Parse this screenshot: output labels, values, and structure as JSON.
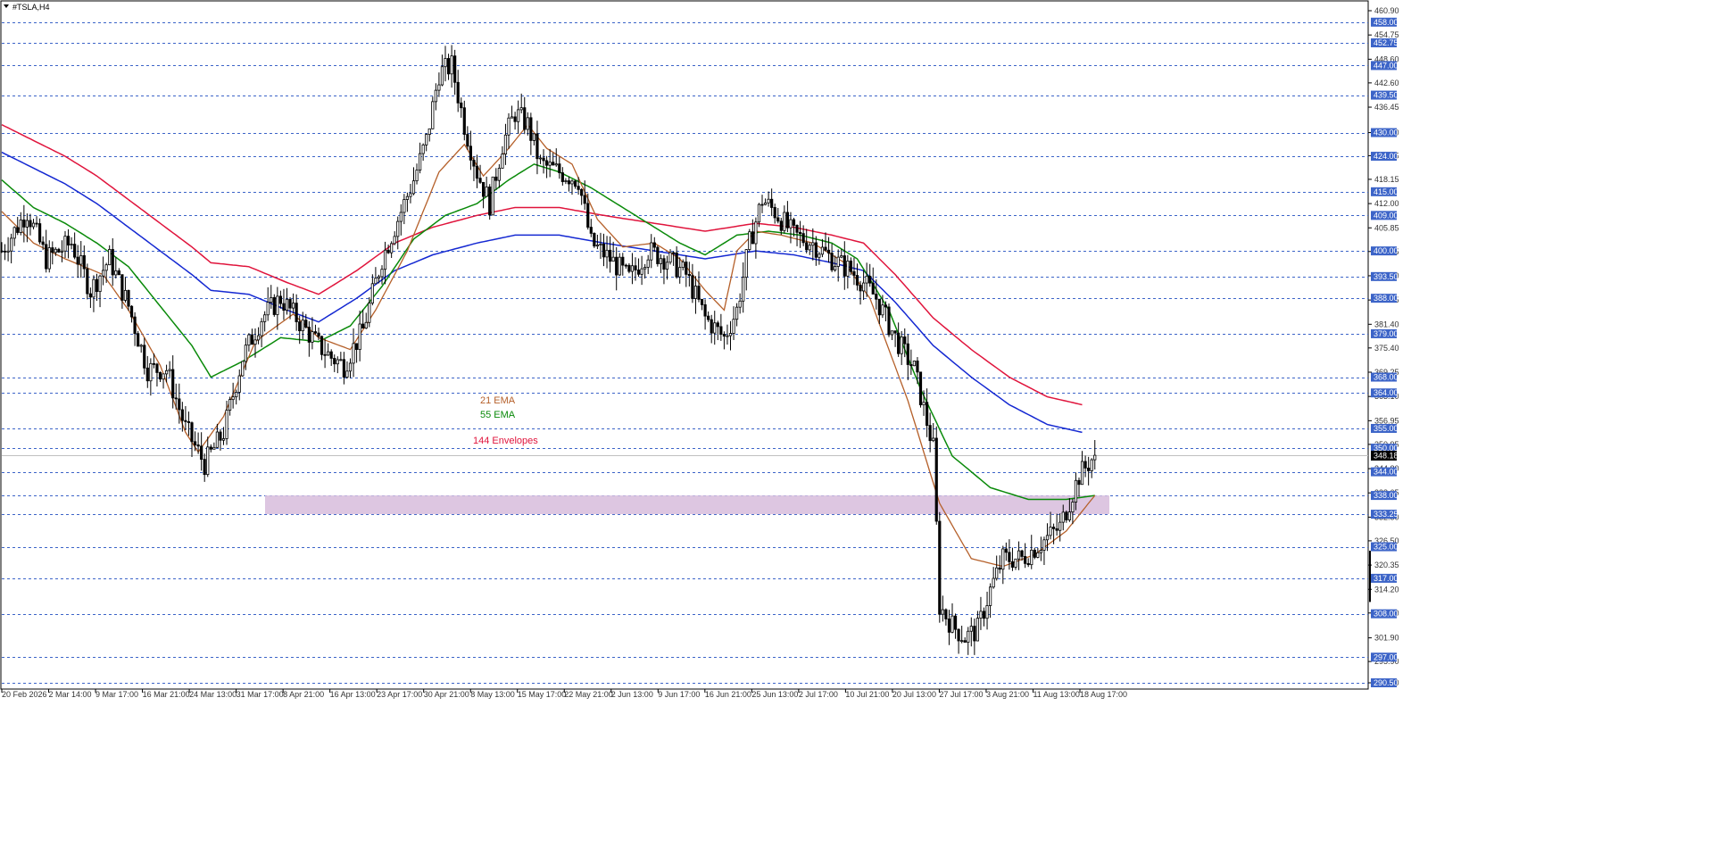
{
  "symbol": "#TSLA,H4",
  "chart_data": {
    "type": "candlestick",
    "title": "#TSLA,H4",
    "y_axis": {
      "min": 290.5,
      "max": 460.9,
      "ticks": [
        460.9,
        454.75,
        448.6,
        442.6,
        436.45,
        430.0,
        424.15,
        418.15,
        412.0,
        405.85,
        399.85,
        393.7,
        387.55,
        381.4,
        375.4,
        369.25,
        363.1,
        356.95,
        350.95,
        344.8,
        338.65,
        332.5,
        326.5,
        320.35,
        314.2,
        308.2,
        301.9,
        295.9,
        290.5
      ]
    },
    "x_axis": {
      "labels": [
        "20 Feb 2026",
        "2 Mar 14:00",
        "9 Mar 17:00",
        "16 Mar 21:00",
        "24 Mar 13:00",
        "31 Mar 17:00",
        "8 Apr 21:00",
        "16 Apr 13:00",
        "23 Apr 17:00",
        "30 Apr 21:00",
        "8 May 13:00",
        "15 May 17:00",
        "22 May 21:00",
        "2 Jun 13:00",
        "9 Jun 17:00",
        "16 Jun 21:00",
        "25 Jun 13:00",
        "2 Jul 17:00",
        "10 Jul 21:00",
        "20 Jul 13:00",
        "27 Jul 17:00",
        "3 Aug 21:00",
        "11 Aug 13:00",
        "18 Aug 17:00"
      ]
    },
    "horizontal_levels": [
      458.0,
      452.75,
      447.0,
      439.5,
      430.0,
      424.0,
      415.0,
      409.0,
      400.0,
      393.5,
      388.0,
      379.0,
      368.0,
      364.0,
      355.0,
      350.0,
      344.0,
      338.0,
      333.25,
      325.0,
      317.0,
      308.0,
      297.0,
      290.5
    ],
    "current_price": 348.18,
    "support_zone": {
      "low": 333.25,
      "high": 338.0
    },
    "annotations": [
      "21 EMA",
      "55 EMA",
      "144 Envelopes"
    ],
    "colors": {
      "ema21": "#b5602a",
      "ema55": "#0a8a0a",
      "envelope_upper": "#e0143c",
      "envelope_lower": "#1428d2",
      "level_line": "#3c64c8",
      "label_box": "#3c64c8",
      "zone": "#d9c0de",
      "candle": "#000000",
      "current_price_box": "#000000"
    },
    "series": [
      {
        "name": "21 EMA",
        "anchors": [
          [
            0,
            410
          ],
          [
            10,
            402
          ],
          [
            20,
            398
          ],
          [
            32,
            394
          ],
          [
            40,
            385
          ],
          [
            50,
            371
          ],
          [
            58,
            354
          ],
          [
            62,
            349
          ],
          [
            70,
            358
          ],
          [
            80,
            377
          ],
          [
            92,
            384
          ],
          [
            100,
            378
          ],
          [
            110,
            375
          ],
          [
            118,
            385
          ],
          [
            128,
            400
          ],
          [
            138,
            420
          ],
          [
            146,
            427
          ],
          [
            152,
            419
          ],
          [
            160,
            426
          ],
          [
            166,
            432
          ],
          [
            172,
            426
          ],
          [
            180,
            422
          ],
          [
            188,
            408
          ],
          [
            196,
            401
          ],
          [
            206,
            402
          ],
          [
            214,
            398
          ],
          [
            222,
            390
          ],
          [
            228,
            385
          ],
          [
            232,
            400
          ],
          [
            238,
            405
          ],
          [
            246,
            404
          ],
          [
            256,
            402
          ],
          [
            266,
            397
          ],
          [
            274,
            388
          ],
          [
            286,
            362
          ],
          [
            296,
            336
          ],
          [
            306,
            322
          ],
          [
            316,
            320
          ],
          [
            326,
            323
          ],
          [
            336,
            329
          ],
          [
            345,
            338
          ]
        ]
      },
      {
        "name": "55 EMA",
        "anchors": [
          [
            0,
            418
          ],
          [
            10,
            411
          ],
          [
            20,
            407
          ],
          [
            30,
            402
          ],
          [
            40,
            396
          ],
          [
            50,
            386
          ],
          [
            60,
            376
          ],
          [
            66,
            368
          ],
          [
            76,
            372
          ],
          [
            88,
            378
          ],
          [
            100,
            377
          ],
          [
            110,
            381
          ],
          [
            120,
            391
          ],
          [
            130,
            403
          ],
          [
            140,
            409
          ],
          [
            150,
            412
          ],
          [
            160,
            418
          ],
          [
            168,
            422
          ],
          [
            176,
            420
          ],
          [
            186,
            416
          ],
          [
            196,
            411
          ],
          [
            206,
            406
          ],
          [
            214,
            402
          ],
          [
            222,
            399
          ],
          [
            232,
            404
          ],
          [
            242,
            405
          ],
          [
            252,
            404
          ],
          [
            262,
            402
          ],
          [
            270,
            398
          ],
          [
            280,
            385
          ],
          [
            290,
            365
          ],
          [
            300,
            348
          ],
          [
            312,
            340
          ],
          [
            324,
            337
          ],
          [
            336,
            337
          ],
          [
            345,
            338
          ]
        ]
      },
      {
        "name": "upper envelope",
        "anchors": [
          [
            0,
            432
          ],
          [
            10,
            428
          ],
          [
            20,
            424
          ],
          [
            30,
            419
          ],
          [
            40,
            413
          ],
          [
            50,
            407
          ],
          [
            60,
            401
          ],
          [
            66,
            397
          ],
          [
            78,
            396
          ],
          [
            90,
            392
          ],
          [
            100,
            389
          ],
          [
            112,
            395
          ],
          [
            124,
            402
          ],
          [
            136,
            406
          ],
          [
            150,
            409
          ],
          [
            162,
            411
          ],
          [
            176,
            411
          ],
          [
            190,
            409
          ],
          [
            206,
            407
          ],
          [
            222,
            405
          ],
          [
            238,
            407
          ],
          [
            250,
            406
          ],
          [
            262,
            404
          ],
          [
            272,
            402
          ],
          [
            282,
            394
          ],
          [
            294,
            383
          ],
          [
            306,
            375
          ],
          [
            318,
            368
          ],
          [
            330,
            363
          ],
          [
            341,
            361
          ]
        ]
      },
      {
        "name": "lower envelope",
        "anchors": [
          [
            0,
            425
          ],
          [
            10,
            421
          ],
          [
            20,
            417
          ],
          [
            30,
            412
          ],
          [
            40,
            406
          ],
          [
            50,
            400
          ],
          [
            60,
            394
          ],
          [
            66,
            390
          ],
          [
            78,
            389
          ],
          [
            90,
            385
          ],
          [
            100,
            382
          ],
          [
            112,
            388
          ],
          [
            124,
            395
          ],
          [
            136,
            399
          ],
          [
            150,
            402
          ],
          [
            162,
            404
          ],
          [
            176,
            404
          ],
          [
            190,
            402
          ],
          [
            206,
            400
          ],
          [
            222,
            398
          ],
          [
            238,
            400
          ],
          [
            250,
            399
          ],
          [
            262,
            397
          ],
          [
            272,
            395
          ],
          [
            282,
            387
          ],
          [
            294,
            376
          ],
          [
            306,
            368
          ],
          [
            318,
            361
          ],
          [
            330,
            356
          ],
          [
            341,
            354
          ]
        ]
      },
      {
        "name": "price",
        "anchors": [
          [
            0,
            400
          ],
          [
            8,
            410
          ],
          [
            14,
            398
          ],
          [
            22,
            402
          ],
          [
            28,
            390
          ],
          [
            34,
            398
          ],
          [
            40,
            386
          ],
          [
            46,
            370
          ],
          [
            52,
            370
          ],
          [
            58,
            355
          ],
          [
            64,
            346
          ],
          [
            70,
            354
          ],
          [
            76,
            373
          ],
          [
            82,
            383
          ],
          [
            88,
            388
          ],
          [
            94,
            382
          ],
          [
            100,
            376
          ],
          [
            104,
            373
          ],
          [
            108,
            371
          ],
          [
            114,
            380
          ],
          [
            120,
            398
          ],
          [
            126,
            410
          ],
          [
            130,
            418
          ],
          [
            134,
            428
          ],
          [
            138,
            445
          ],
          [
            142,
            447
          ],
          [
            146,
            432
          ],
          [
            150,
            420
          ],
          [
            154,
            412
          ],
          [
            158,
            427
          ],
          [
            162,
            435
          ],
          [
            166,
            432
          ],
          [
            170,
            422
          ],
          [
            176,
            420
          ],
          [
            182,
            418
          ],
          [
            186,
            402
          ],
          [
            192,
            398
          ],
          [
            198,
            393
          ],
          [
            204,
            400
          ],
          [
            210,
            398
          ],
          [
            216,
            394
          ],
          [
            222,
            383
          ],
          [
            228,
            378
          ],
          [
            232,
            385
          ],
          [
            236,
            402
          ],
          [
            240,
            413
          ],
          [
            244,
            410
          ],
          [
            250,
            404
          ],
          [
            256,
            402
          ],
          [
            262,
            398
          ],
          [
            268,
            395
          ],
          [
            272,
            392
          ],
          [
            276,
            388
          ],
          [
            282,
            378
          ],
          [
            288,
            370
          ],
          [
            294,
            350
          ],
          [
            296,
            310
          ],
          [
            300,
            305
          ],
          [
            304,
            302
          ],
          [
            308,
            304
          ],
          [
            312,
            314
          ],
          [
            316,
            322
          ],
          [
            322,
            322
          ],
          [
            328,
            326
          ],
          [
            334,
            330
          ],
          [
            340,
            343
          ],
          [
            345,
            348.18
          ]
        ]
      }
    ]
  }
}
